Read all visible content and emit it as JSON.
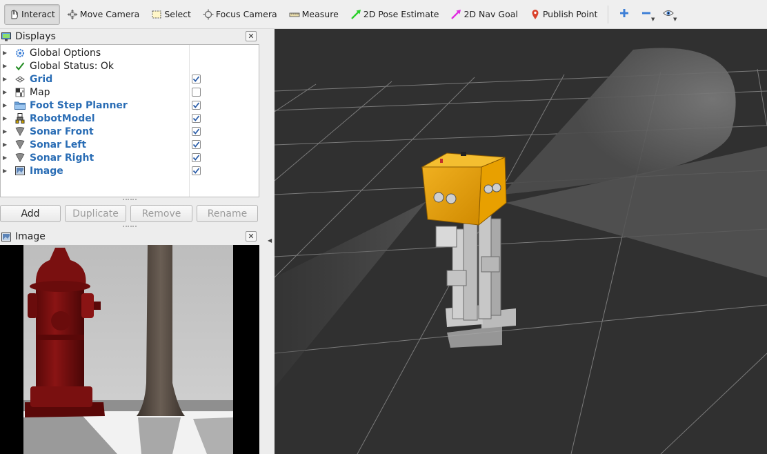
{
  "toolbar": {
    "tools": [
      {
        "label": "Interact",
        "icon": "cursor-hand-icon",
        "active": true
      },
      {
        "label": "Move Camera",
        "icon": "move-camera-icon",
        "active": false
      },
      {
        "label": "Select",
        "icon": "select-box-icon",
        "active": false
      },
      {
        "label": "Focus Camera",
        "icon": "focus-crosshair-icon",
        "active": false
      },
      {
        "label": "Measure",
        "icon": "ruler-icon",
        "active": false
      },
      {
        "label": "2D Pose Estimate",
        "icon": "green-arrow-icon",
        "active": false
      },
      {
        "label": "2D Nav Goal",
        "icon": "magenta-arrow-icon",
        "active": false
      },
      {
        "label": "Publish Point",
        "icon": "map-pin-icon",
        "active": false
      }
    ],
    "extras": [
      "add-tool-icon",
      "remove-tool-icon",
      "view-eye-icon"
    ]
  },
  "displays_panel": {
    "title": "Displays",
    "items": [
      {
        "label": "Global Options",
        "icon": "gear-icon",
        "bold": false,
        "has_checkbox": false,
        "checked": false
      },
      {
        "label": "Global Status: Ok",
        "icon": "checkmark-icon",
        "bold": false,
        "has_checkbox": false,
        "checked": false
      },
      {
        "label": "Grid",
        "icon": "grid-icon",
        "bold": true,
        "has_checkbox": true,
        "checked": true
      },
      {
        "label": "Map",
        "icon": "map-icon",
        "bold": false,
        "has_checkbox": true,
        "checked": false
      },
      {
        "label": "Foot Step Planner",
        "icon": "folder-icon",
        "bold": true,
        "has_checkbox": true,
        "checked": true
      },
      {
        "label": "RobotModel",
        "icon": "robot-icon",
        "bold": true,
        "has_checkbox": true,
        "checked": true
      },
      {
        "label": "Sonar Front",
        "icon": "range-cone-icon",
        "bold": true,
        "has_checkbox": true,
        "checked": true
      },
      {
        "label": "Sonar Left",
        "icon": "range-cone-icon",
        "bold": true,
        "has_checkbox": true,
        "checked": true
      },
      {
        "label": "Sonar Right",
        "icon": "range-cone-icon",
        "bold": true,
        "has_checkbox": true,
        "checked": true
      },
      {
        "label": "Image",
        "icon": "image-icon",
        "bold": true,
        "has_checkbox": true,
        "checked": true
      }
    ],
    "buttons": {
      "add": "Add",
      "duplicate": "Duplicate",
      "remove": "Remove",
      "rename": "Rename"
    }
  },
  "image_panel": {
    "title": "Image"
  },
  "colors": {
    "accent_blue": "#2a6db5",
    "viewport_bg": "#303030",
    "robot_head": "#e8a000",
    "hydrant": "#7a1010"
  }
}
